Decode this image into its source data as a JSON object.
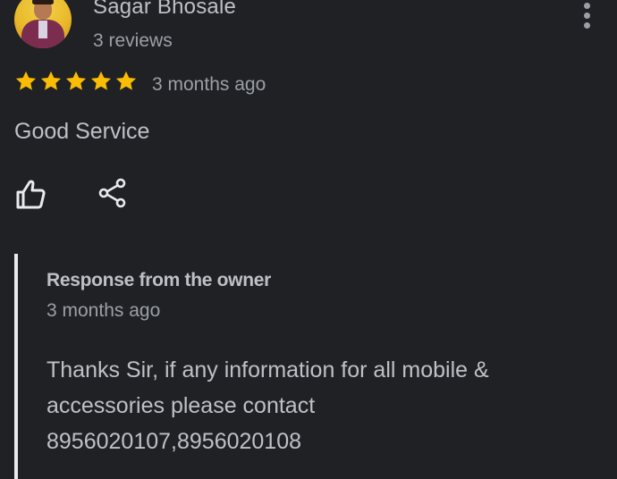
{
  "review": {
    "author_name": "Sagar Bhosale",
    "author_reviews": "3 reviews",
    "rating": 5,
    "rating_max": 5,
    "time": "3 months ago",
    "text": "Good Service"
  },
  "icons": {
    "avatar": "avatar-photo",
    "more": "more-vert-icon",
    "star": "star-icon",
    "like": "thumbs-up-icon",
    "share": "share-icon"
  },
  "colors": {
    "background": "#202124",
    "star": "#fbbc04",
    "text_primary": "#bdc1c6",
    "text_secondary": "#9aa0a6"
  },
  "owner_response": {
    "title": "Response from the owner",
    "time": "3 months ago",
    "text_line1": "Thanks Sir, if any information for all mobile &",
    "text_line2": "accessories please contact",
    "text_line3": "8956020107,8956020108"
  }
}
